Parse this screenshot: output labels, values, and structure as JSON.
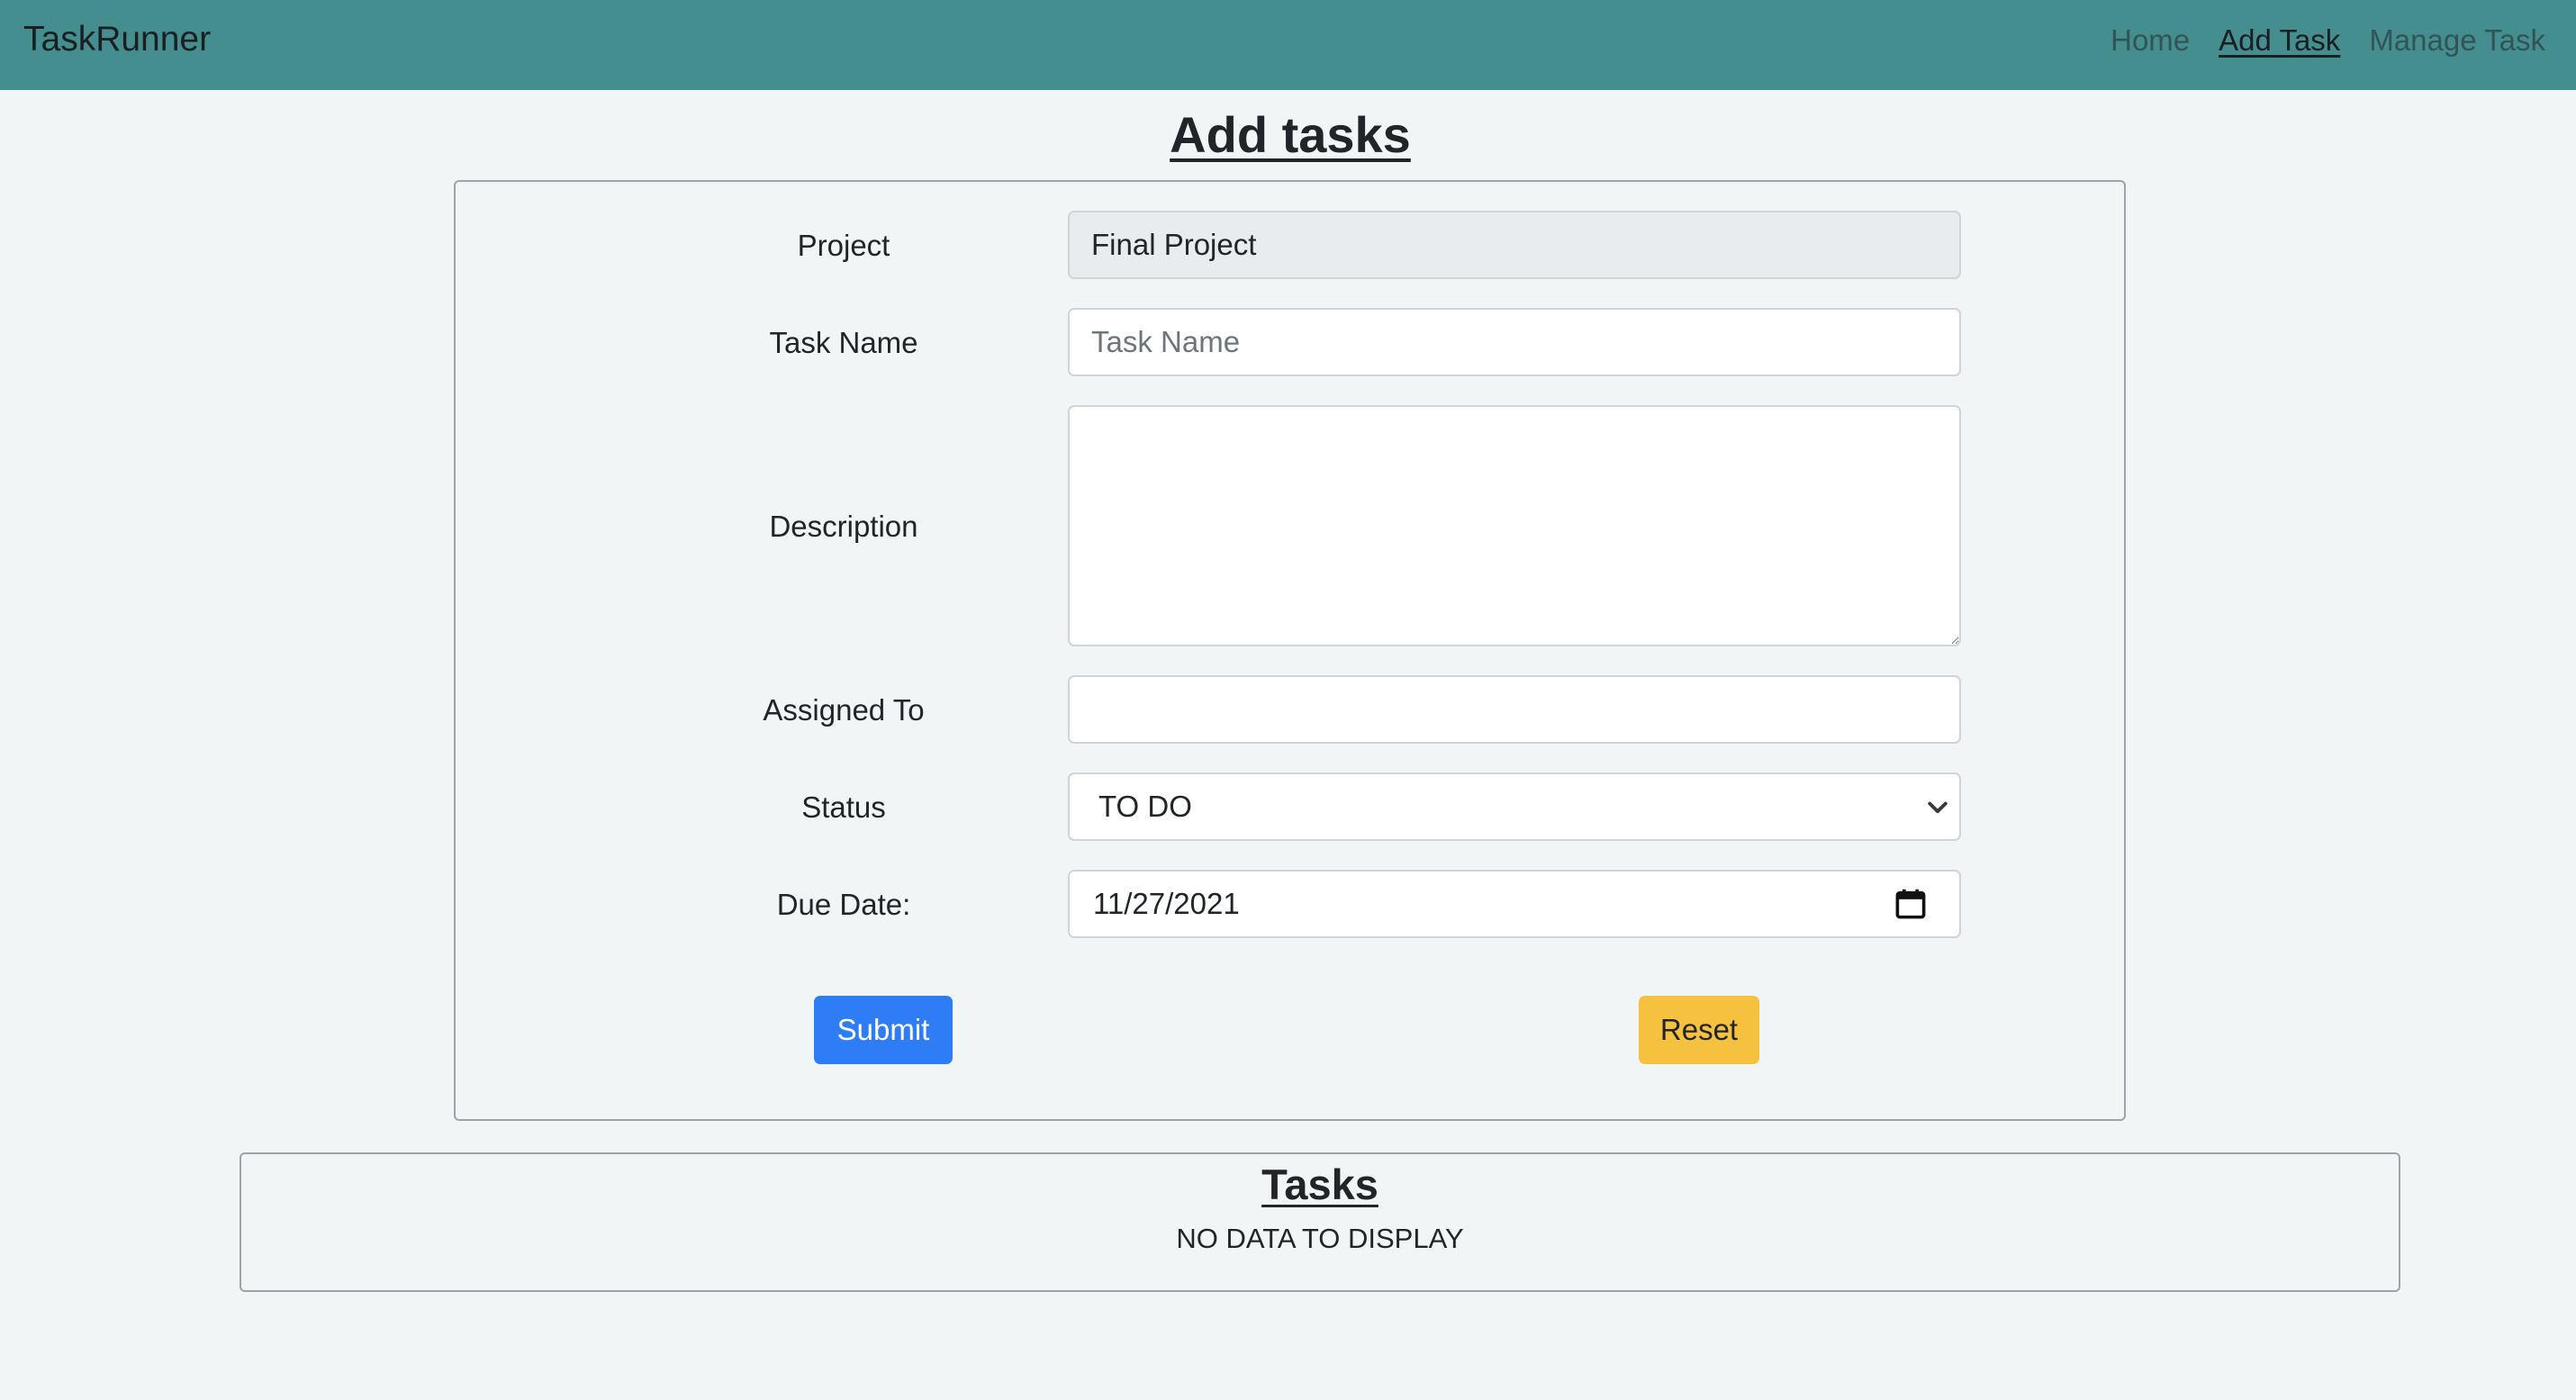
{
  "navbar": {
    "brand": "TaskRunner",
    "links": [
      {
        "label": "Home",
        "active": false
      },
      {
        "label": "Add Task",
        "active": true
      },
      {
        "label": "Manage Task",
        "active": false
      }
    ],
    "background_color": "#448e8f"
  },
  "page": {
    "title": "Add tasks"
  },
  "form": {
    "project": {
      "label": "Project",
      "value": "Final Project"
    },
    "task_name": {
      "label": "Task Name",
      "value": "",
      "placeholder": "Task Name"
    },
    "description": {
      "label": "Description",
      "value": ""
    },
    "assigned_to": {
      "label": "Assigned To",
      "value": ""
    },
    "status": {
      "label": "Status",
      "value": "TO DO"
    },
    "due_date": {
      "label": "Due Date:",
      "value": "11/27/2021"
    },
    "submit_label": "Submit",
    "reset_label": "Reset",
    "submit_color": "#2f7df6",
    "reset_color": "#f7c140"
  },
  "tasks": {
    "title": "Tasks",
    "empty_message": "NO DATA TO DISPLAY"
  }
}
